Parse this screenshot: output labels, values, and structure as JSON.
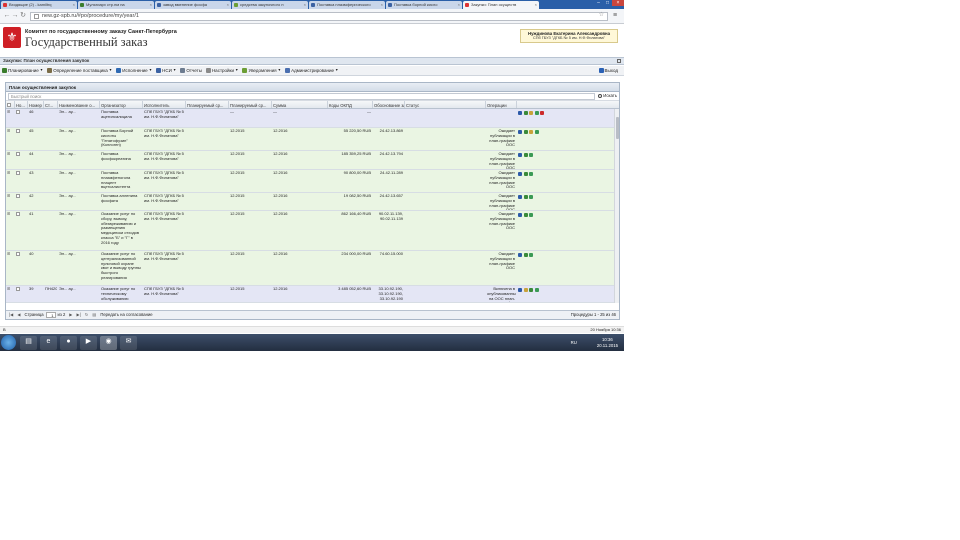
{
  "browser": {
    "tabs": [
      {
        "label": "Входящие (2) - kamiltrq",
        "active": false
      },
      {
        "label": "Мультиарх стр.нм на",
        "active": false
      },
      {
        "label": "завод вменение фосфа",
        "active": false
      },
      {
        "label": "средства закупочного п",
        "active": false
      },
      {
        "label": "Поставка плазмферического",
        "active": false
      },
      {
        "label": "Поставка борной кисло",
        "active": false
      },
      {
        "label": "Закупки: План осуществ",
        "active": true
      }
    ],
    "url": "new.gz-spb.ru/#po/procedure/my/year/1"
  },
  "header": {
    "org": "Комитет по государственному заказу Санкт-Петербурга",
    "brand": "Государственный заказ",
    "user_name": "Нуждинова Екатерина Александровна",
    "user_org": "СПб ГБУЗ \"ДГКБ № 5 им. Н.Ф.Филатова\""
  },
  "breadcrumb": "Закупки: План осуществления закупок",
  "menu": [
    {
      "label": "Планирование",
      "color": "#3a7d2c"
    },
    {
      "label": "Определение поставщика",
      "color": "#7a6c47"
    },
    {
      "label": "Исполнение",
      "color": "#2f6ab3"
    },
    {
      "label": "НСИ",
      "color": "#3b62a3"
    },
    {
      "label": "Отчеты",
      "color": "#6d7c90"
    },
    {
      "label": "Настройки",
      "color": "#8a8a8a"
    },
    {
      "label": "Уведомления",
      "color": "#6c9e35"
    },
    {
      "label": "Администрирование",
      "color": "#4b6fb0"
    }
  ],
  "exit_label": "Выход",
  "panel": {
    "title": "План осуществления закупок",
    "search_placeholder": "Быстрый поиск",
    "search_button": "Искать"
  },
  "columns": [
    "Но...",
    "Номер ПГ",
    "Ст...",
    "Наименование о...",
    "Организатор",
    "Исполнитель",
    "Планируемый ср...",
    "Планируемый ср...",
    "Сумма",
    "Коды ОКПД",
    "Обоснование зак...",
    "Статус",
    "Операции"
  ],
  "rows": [
    {
      "num": "46",
      "pg": "",
      "st": "Эл... ау...",
      "name": "Поставка ацетилсалицила",
      "org": "СПб ГБУЗ \"ДГКБ № 5 им. Н.Ф.Филатова\"",
      "exec": "",
      "p1": "—",
      "p2": "—",
      "sum": "—",
      "okpd": "",
      "basis": "",
      "status": "",
      "ops": [
        "#2d5aa8",
        "#3a8a3a",
        "#c8a23a",
        "#3a9a55",
        "#cc2a2a"
      ],
      "tone": "blue"
    },
    {
      "num": "45",
      "pg": "",
      "st": "Эл... ау...",
      "name": "Поставка Борной кислоты \"Гепатофузин\" (Коллоген)",
      "org": "СПб ГБУЗ \"ДГКБ № 5 им. Н.Ф.Филатова\"",
      "exec": "",
      "p1": "12.2015",
      "p2": "12.2016",
      "sum": "55 220,50 RUB",
      "okpd": "24.42.13.869",
      "basis": "",
      "status": "Ожидает публикации в план-графике ООС",
      "ops": [
        "#2d5aa8",
        "#3a8a3a",
        "#c8a23a",
        "#3a9a55"
      ],
      "tone": "green"
    },
    {
      "num": "44",
      "pg": "",
      "st": "Эл... ау...",
      "name": "Поставка фосфокреатина",
      "org": "СПб ГБУЗ \"ДГКБ № 5 им. Н.Ф.Филатова\"",
      "exec": "",
      "p1": "12.2015",
      "p2": "12.2016",
      "sum": "185 359,25 RUB",
      "okpd": "24.42.13.794",
      "basis": "",
      "status": "Ожидает публикации в план-графике ООС",
      "ops": [
        "#2d5aa8",
        "#3a8a3a",
        "#3a9a55"
      ],
      "tone": "green"
    },
    {
      "num": "43",
      "pg": "",
      "st": "Эл... ау...",
      "name": "Поставка плазмфеногола плацент вцетсалистента",
      "org": "СПб ГБУЗ \"ДГКБ № 5 им. Н.Ф.Филатова\"",
      "exec": "",
      "p1": "12.2015",
      "p2": "12.2016",
      "sum": "90 800,00 RUB",
      "okpd": "24.42.11.289",
      "basis": "",
      "status": "Ожидает публикации в план-графике ООС",
      "ops": [
        "#2d5aa8",
        "#3a8a3a",
        "#3a9a55"
      ],
      "tone": "green"
    },
    {
      "num": "42",
      "pg": "",
      "st": "Эл... ау...",
      "name": "Поставка алленина фосфата",
      "org": "СПб ГБУЗ \"ДГКБ № 5 им. Н.Ф.Филатова\"",
      "exec": "",
      "p1": "12.2015",
      "p2": "12.2016",
      "sum": "19 082,50 RUB",
      "okpd": "24.42.13.657",
      "basis": "",
      "status": "Ожидает публикации в план-графике ООС",
      "ops": [
        "#2d5aa8",
        "#3a8a3a",
        "#3a9a55"
      ],
      "tone": "green"
    },
    {
      "num": "41",
      "pg": "",
      "st": "Эл... ау...",
      "name": "Оказание услуг по сбору, вывозу, обезвреживанию и размещению медицински отходов класса \"Б\" и \"Г\" в 2016 году",
      "org": "СПб ГБУЗ \"ДГКБ № 5 им. Н.Ф.Филатова\"",
      "exec": "",
      "p1": "12.2015",
      "p2": "12.2016",
      "sum": "862 166,40 RUB",
      "okpd": "90.02.11.139, 90.02.11.139",
      "basis": "",
      "status": "Ожидает публикации в план-графике ООС",
      "ops": [
        "#2d5aa8",
        "#3a8a3a",
        "#3a9a55"
      ],
      "tone": "green"
    },
    {
      "num": "40",
      "pg": "",
      "st": "Эл... ау...",
      "name": "Оказание услуг по централизованной пультовой охране квот и выводу группы быстрого реагирования",
      "org": "СПб ГБУЗ \"ДГКБ № 5 им. Н.Ф.Филатова\"",
      "exec": "",
      "p1": "12.2015",
      "p2": "12.2016",
      "sum": "234 000,00 RUB",
      "okpd": "74.60.15.000",
      "basis": "",
      "status": "Ожидает публикации в план-графике ООС",
      "ops": [
        "#2d5aa8",
        "#3a8a3a",
        "#3a9a55"
      ],
      "tone": "green"
    },
    {
      "num": "39",
      "pg": "ПН4201502...",
      "st": "Эл... ау...",
      "name": "Оказание услуг по техническому обслуживанию медицинского",
      "org": "СПб ГБУЗ \"ДГКБ № 5 им. Н.Ф.Филатова\"",
      "exec": "",
      "p1": "12.2015",
      "p2": "12.2016",
      "sum": "3 485 052,60 RUB",
      "okpd": "33.10.92.190, 33.10.92.190, 33.10.92.190",
      "basis": "",
      "status": "Включена в опубликованный на ООС план-график",
      "ops": [
        "#2d5aa8",
        "#c8a23a",
        "#3a8a3a",
        "#3a9a55"
      ],
      "tone": "blue"
    }
  ],
  "pager": {
    "page_label": "Страница",
    "page_value": "1",
    "of_label": "из 2",
    "transfer_label": "Передать на согласование",
    "summary": "Процедуры 1 - 25 из 46"
  },
  "status_left": "В",
  "status_right": "20 Ноября 10:36",
  "taskbar": {
    "lang": "RU",
    "time": "10:36",
    "date": "20.11.2015"
  }
}
